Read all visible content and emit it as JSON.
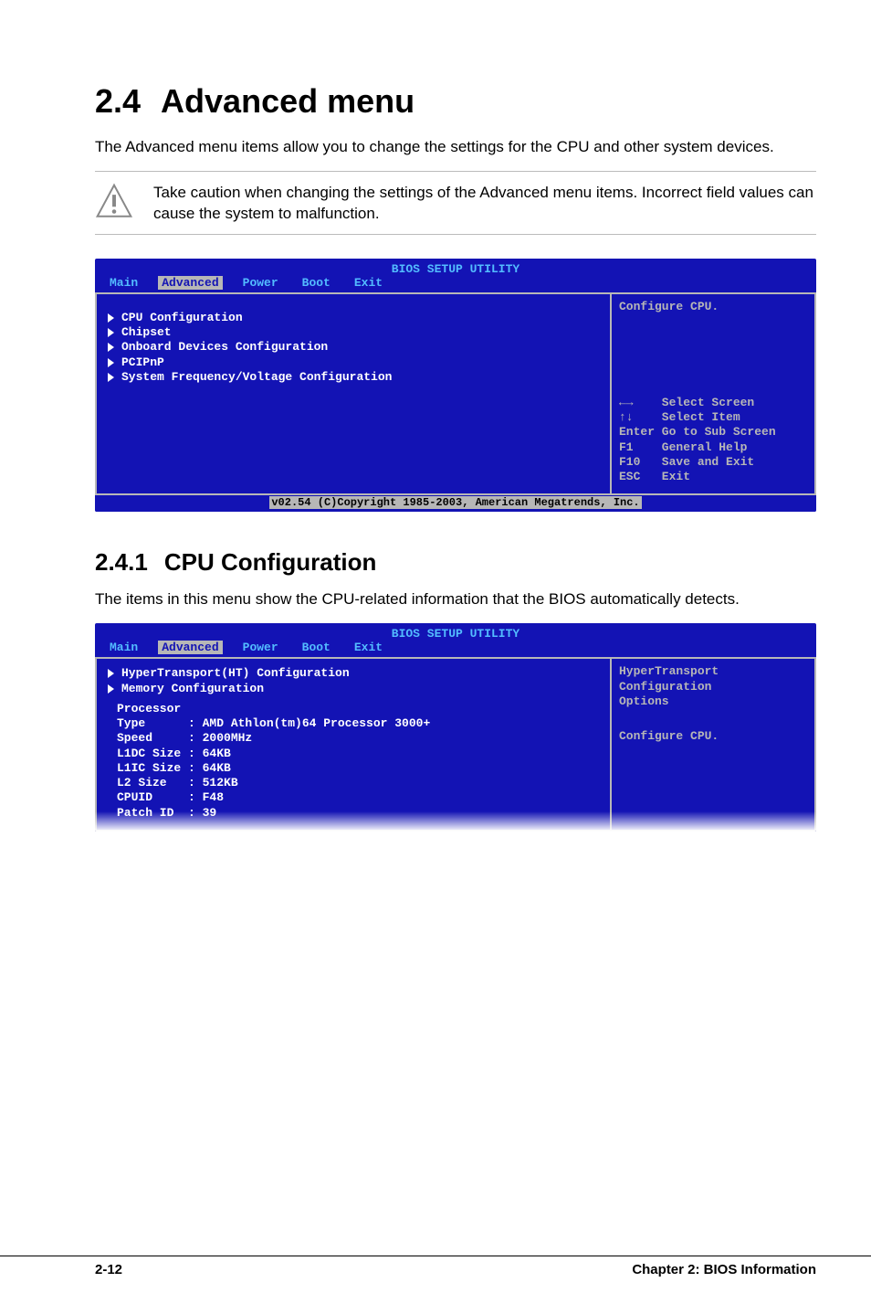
{
  "section": {
    "number": "2.4",
    "title": "Advanced menu",
    "intro": "The Advanced menu items allow you to change the settings for the CPU and other system devices.",
    "caution": "Take caution when changing the settings of the Advanced menu items. Incorrect field values can cause the system to malfunction."
  },
  "bios1": {
    "title": "BIOS SETUP UTILITY",
    "tabs": {
      "main": "Main",
      "advanced": "Advanced",
      "power": "Power",
      "boot": "Boot",
      "exit": "Exit"
    },
    "menu": [
      "CPU Configuration",
      "Chipset",
      "Onboard Devices Configuration",
      "PCIPnP",
      "System Frequency/Voltage Configuration"
    ],
    "help_top": "Configure CPU.",
    "nav": "←→    Select Screen\n↑↓    Select Item\nEnter Go to Sub Screen\nF1    General Help\nF10   Save and Exit\nESC   Exit",
    "footer": "v02.54 (C)Copyright 1985-2003, American Megatrends, Inc."
  },
  "subsection": {
    "number": "2.4.1",
    "title": "CPU Configuration",
    "intro": "The items in this menu show the CPU-related information that the BIOS automatically detects."
  },
  "bios2": {
    "title": "BIOS SETUP UTILITY",
    "tabs": {
      "main": "Main",
      "advanced": "Advanced",
      "power": "Power",
      "boot": "Boot",
      "exit": "Exit"
    },
    "menu": [
      "HyperTransport(HT) Configuration",
      "Memory Configuration"
    ],
    "proc_header": "Processor",
    "info": {
      "type": "Type      : AMD Athlon(tm)64 Processor 3000+",
      "speed": "Speed     : 2000MHz",
      "l1dc": "L1DC Size : 64KB",
      "l1ic": "L1IC Size : 64KB",
      "l2": "L2 Size   : 512KB",
      "cpuid": "CPUID     : F48",
      "patch": "Patch ID  : 39"
    },
    "help_top": "HyperTransport\nConfiguration\nOptions",
    "help_mid": "Configure CPU."
  },
  "footer": {
    "left": "2-12",
    "right": "Chapter 2: BIOS Information"
  }
}
